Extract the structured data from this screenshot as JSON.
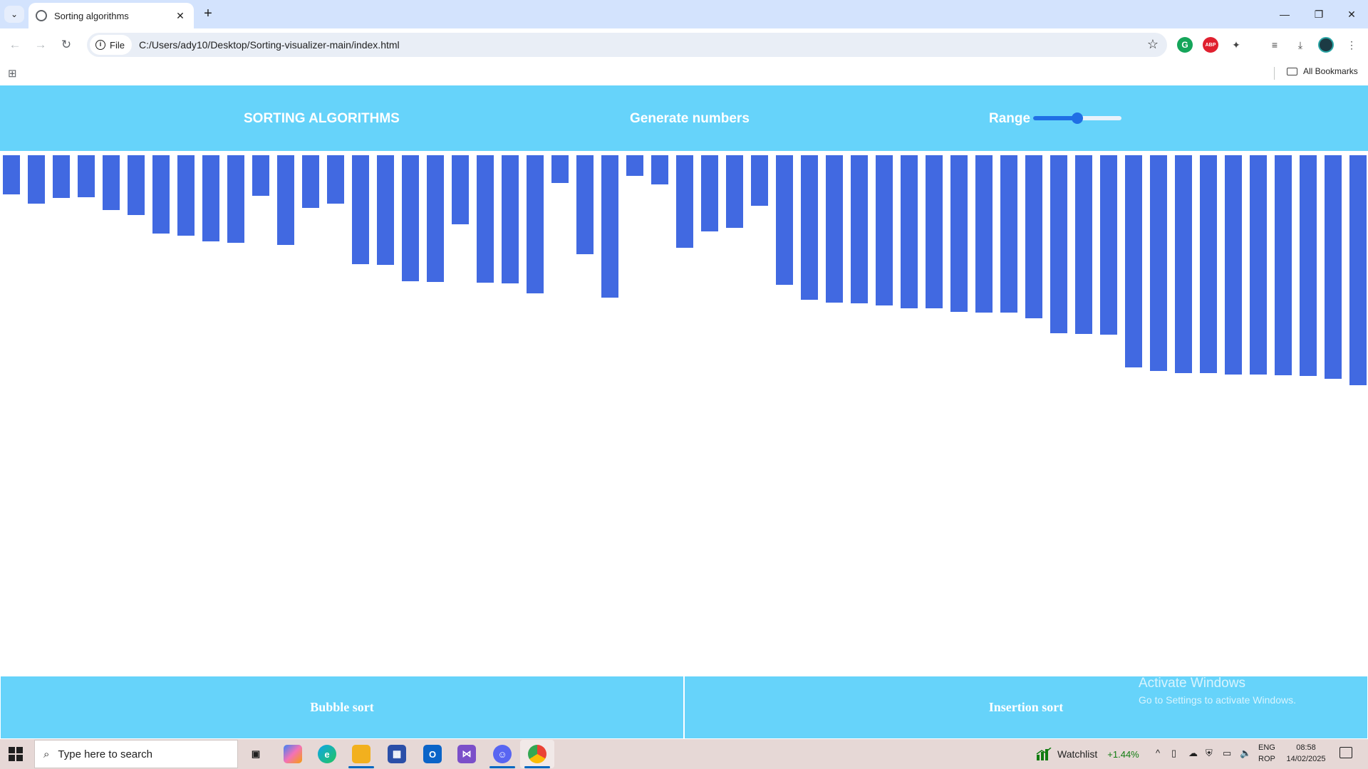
{
  "browser": {
    "tab_title": "Sorting algorithms",
    "tab_close": "✕",
    "new_tab": "+",
    "file_label": "File",
    "url": "C:/Users/ady10/Desktop/Sorting-visualizer-main/index.html",
    "all_bookmarks": "All Bookmarks",
    "window_controls": {
      "minimize": "—",
      "restore": "❐",
      "close": "✕"
    }
  },
  "app": {
    "title": "SORTING ALGORITHMS",
    "generate_label": "Generate numbers",
    "range_label": "Range",
    "range_value_fraction": 0.5,
    "bar_color": "#4169e1",
    "navbar_color": "#66d3fa",
    "bar_values": [
      55,
      68,
      60,
      59,
      77,
      84,
      110,
      113,
      121,
      123,
      57,
      126,
      74,
      68,
      153,
      154,
      177,
      178,
      97,
      179,
      180,
      194,
      39,
      139,
      200,
      29,
      41,
      130,
      107,
      102,
      71,
      182,
      203,
      207,
      208,
      211,
      215,
      215,
      220,
      221,
      221,
      229,
      250,
      251,
      252,
      298,
      303,
      306,
      306,
      308,
      308,
      309,
      310,
      314,
      323
    ],
    "buttons": {
      "bubble": "Bubble sort",
      "insertion": "Insertion sort"
    }
  },
  "watermark": {
    "line1": "Activate Windows",
    "line2": "Go to Settings to activate Windows."
  },
  "taskbar": {
    "search_placeholder": "Type here to search",
    "watchlist_label": "Watchlist",
    "watchlist_delta": "+1.44%",
    "lang_line1": "ENG",
    "lang_line2": "ROP",
    "time": "08:58",
    "date": "14/02/2025"
  }
}
